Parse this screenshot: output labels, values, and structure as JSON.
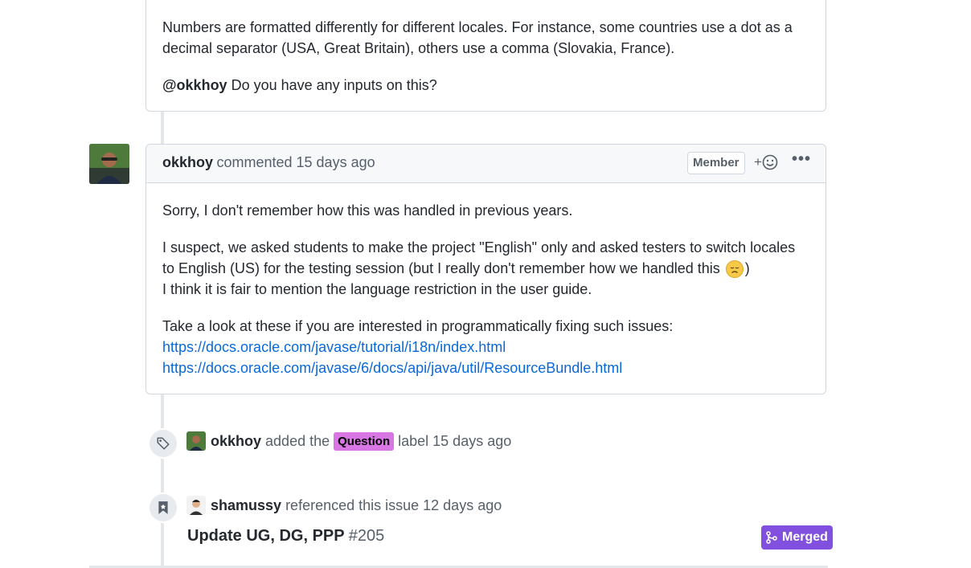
{
  "first_comment": {
    "para1": "Numbers are formatted differently for different locales. For instance, some countries use a dot as a decimal separator (USA, Great Britain), others use a comma (Slovakia, France).",
    "mention": "@okkhoy",
    "para2_rest": " Do you have any inputs on this?"
  },
  "second_comment": {
    "author": "okkhoy",
    "meta": "commented 15 days ago",
    "role": "Member",
    "react_label": "+",
    "more_label": "•••",
    "line1": "Sorry, I don't remember how this was handled in previous years.",
    "line2a": "I suspect, we asked students to make the project \"English\" only and asked testers to switch locales to English (US) for the testing session (but I really don't remember how we handled this ",
    "line2b": ")",
    "line3": "I think it is fair to mention the language restriction in the user guide.",
    "line4": "Take a look at these if you are interested in programmatically fixing such issues:",
    "link1": "https://docs.oracle.com/javase/tutorial/i18n/index.html",
    "link2": "https://docs.oracle.com/javase/6/docs/api/java/util/ResourceBundle.html"
  },
  "label_event": {
    "actor": "okkhoy",
    "text_before": "added the",
    "label": "Question",
    "label_color": "#d876e3",
    "text_after": "label 15 days ago"
  },
  "reference_event": {
    "actor": "shamussy",
    "text": "referenced this issue 12 days ago",
    "pr_title": "Update UG, DG, PPP",
    "pr_number": "#205",
    "status": "Merged",
    "status_color": "#8250df"
  }
}
